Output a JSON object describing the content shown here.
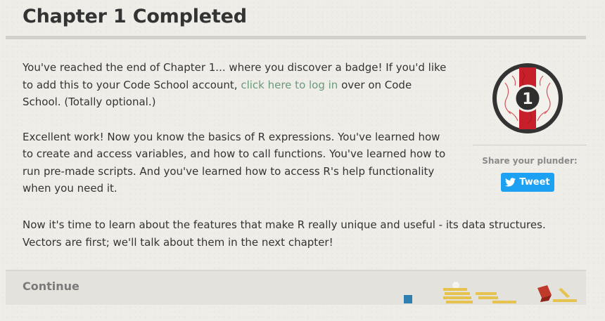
{
  "page": {
    "title": "Chapter 1 Completed"
  },
  "content": {
    "p1_before_link": "You've reached the end of Chapter 1... where you discover a badge! If you'd like to add this to your Code School account, ",
    "p1_link": "click here to log in",
    "p1_after_link": " over on Code School. (Totally optional.)",
    "p2": "Excellent work! Now you know the basics of R expressions. You've learned how to create and access variables, and how to call functions. You've learned how to run pre-made scripts. And you've learned how to access R's help functionality when you need it.",
    "p3": "Now it's time to learn about the features that make R really unique and useful - its data structures. Vectors are first; we'll talk about them in the next chapter!"
  },
  "sidebar": {
    "badge_number": "1",
    "share_label": "Share your plunder:",
    "tweet_label": "Tweet"
  },
  "footer": {
    "continue_label": "Continue"
  },
  "colors": {
    "link": "#6a9a7a",
    "tweet": "#1da1f2",
    "badge_red": "#c8202a",
    "badge_ring": "#333333"
  },
  "icons": {
    "badge": "chapter-badge-icon",
    "tweet": "twitter-bird-icon",
    "decor": "treasure-decoration"
  }
}
